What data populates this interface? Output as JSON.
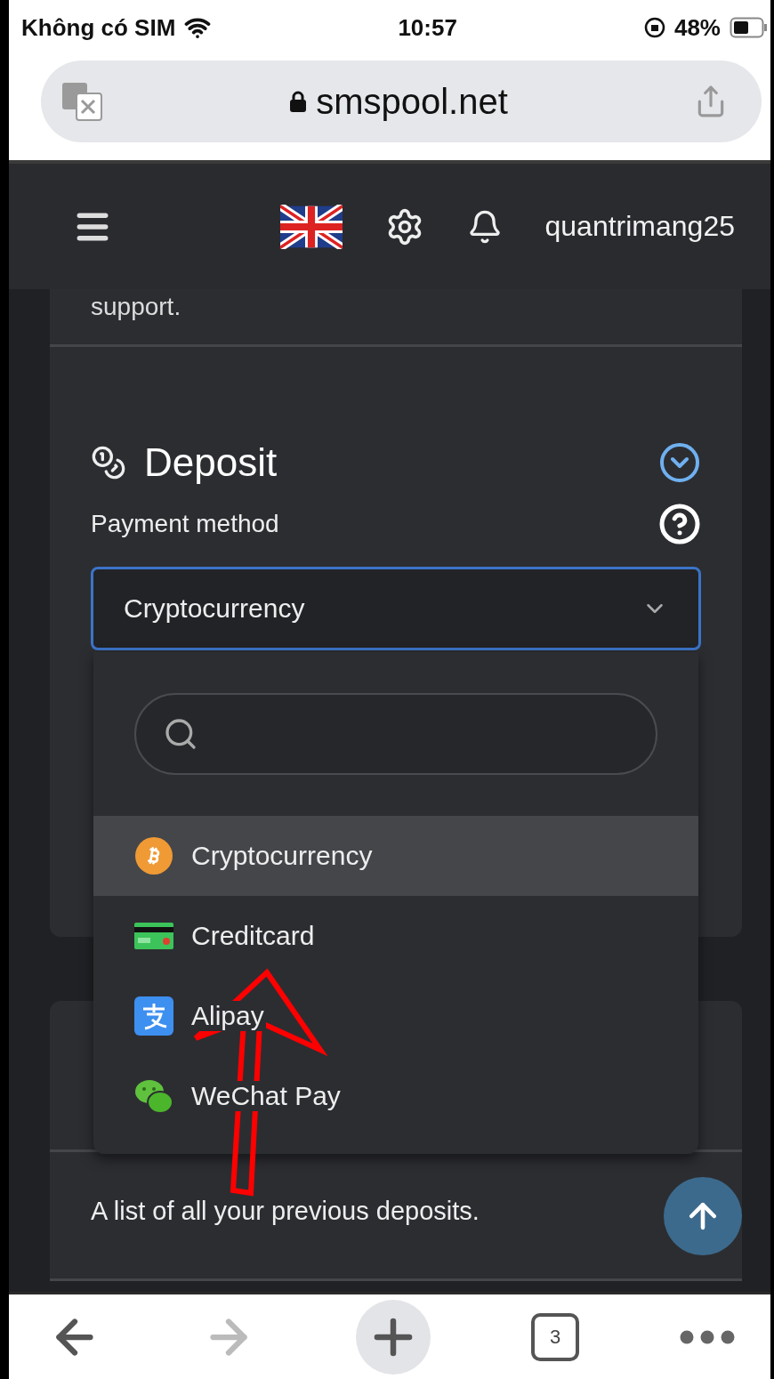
{
  "status_bar": {
    "carrier": "Không có SIM",
    "time": "10:57",
    "battery": "48%"
  },
  "address_bar": {
    "url": "smspool.net"
  },
  "nav": {
    "username": "quantrimang25"
  },
  "previous_card": {
    "text": "support."
  },
  "deposit": {
    "title": "Deposit",
    "label": "Payment method",
    "select": {
      "value": "Cryptocurrency",
      "expanded": true
    },
    "options": [
      {
        "label": "Cryptocurrency",
        "kind": "crypto",
        "selected": true
      },
      {
        "label": "Creditcard",
        "kind": "card",
        "selected": false
      },
      {
        "label": "Alipay",
        "kind": "alipay",
        "selected": false
      },
      {
        "label": "WeChat Pay",
        "kind": "wechat",
        "selected": false
      }
    ]
  },
  "history": {
    "text": "A list of all your previous deposits."
  },
  "toolbar": {
    "tabs_count": "3",
    "forward_disabled": true
  }
}
